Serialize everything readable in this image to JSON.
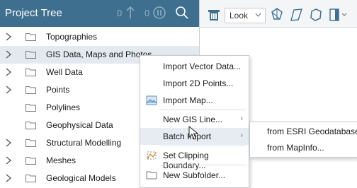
{
  "tree": {
    "title": "Project Tree",
    "counter_up": "0",
    "counter_pause": "0",
    "items": [
      {
        "label": "Topographies",
        "expandable": true
      },
      {
        "label": "GIS Data, Maps and Photos",
        "expandable": true
      },
      {
        "label": "Well Data",
        "expandable": true
      },
      {
        "label": "Points",
        "expandable": true
      },
      {
        "label": "Polylines",
        "expandable": false
      },
      {
        "label": "Geophysical Data",
        "expandable": false
      },
      {
        "label": "Structural Modelling",
        "expandable": true
      },
      {
        "label": "Meshes",
        "expandable": true
      },
      {
        "label": "Geological Models",
        "expandable": true
      }
    ]
  },
  "toolbar": {
    "look_label": "Look"
  },
  "context_menu": {
    "items": [
      {
        "label": "Import Vector Data...",
        "icon": "",
        "submenu": false
      },
      {
        "label": "Import 2D Points...",
        "icon": "",
        "submenu": false
      },
      {
        "label": "Import Map...",
        "icon": "map-image-icon",
        "submenu": false
      },
      {
        "label": "New GIS Line...",
        "icon": "",
        "submenu": true
      },
      {
        "label": "Batch Import",
        "icon": "",
        "submenu": true
      },
      {
        "label": "Set Clipping Boundary...",
        "icon": "clipping-boundary-icon",
        "submenu": false
      },
      {
        "label": "New Subfolder...",
        "icon": "folder-icon",
        "submenu": false
      }
    ]
  },
  "submenu": {
    "items": [
      {
        "label": "from ESRI Geodatabase..."
      },
      {
        "label": "from MapInfo..."
      }
    ]
  },
  "colors": {
    "header": "#3f6f8f",
    "highlight": "#e3e9ef",
    "folder_stroke": "#7a7a7a"
  }
}
